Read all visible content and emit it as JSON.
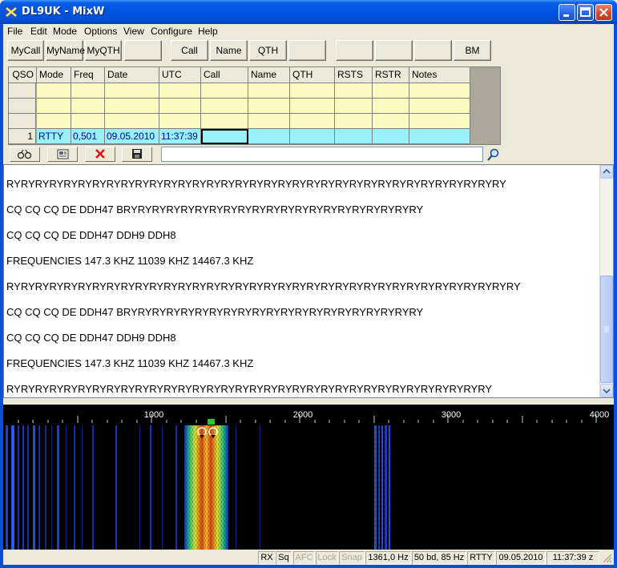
{
  "window": {
    "title": "DL9UK - MixW"
  },
  "menu": [
    "File",
    "Edit",
    "Mode",
    "Options",
    "View",
    "Configure",
    "Help"
  ],
  "buttons": [
    "MyCall",
    "MyName",
    "MyQTH",
    "",
    "Call",
    "Name",
    "QTH",
    "",
    "",
    "",
    "",
    "BM"
  ],
  "grid": {
    "headers": [
      "QSO",
      "Mode",
      "Freq",
      "Date",
      "UTC",
      "Call",
      "Name",
      "QTH",
      "RSTS",
      "RSTR",
      "Notes"
    ],
    "active_row": {
      "qso": "1",
      "mode": "RTTY",
      "freq": "0,501",
      "date": "09.05.2010",
      "utc": "11:37:39",
      "call": "",
      "name": "",
      "qth": "",
      "rsts": "",
      "rstr": "",
      "notes": ""
    }
  },
  "command_input": {
    "value": ""
  },
  "rx_lines": [
    "RYRYRYRYRYRYRYRYRYRYRYRYRYRYRYRYRYRYRYRYRYRYRYRYRYRYRYRYRYRYRYRYRYRYRY",
    "CQ CQ CQ DE DDH47 BRYRYRYRYRYRYRYRYRYRYRYRYRYRYRYRYRYRYRYRYRY",
    "CQ CQ CQ DE DDH47 DDH9 DDH8",
    "FREQUENCIES   147.3 KHZ   11039 KHZ   14467.3 KHZ",
    "RYRYRYRYRYRYRYRYRYRYRYRYRYRYRYRYRYRYRYRYRYRYRYRYRYRYRYRYRYRYRYRYRYRYRYRY",
    "CQ CQ CQ DE DDH47 BRYRYRYRYRYRYRYRYRYRYRYRYRYRYRYRYRYRYRYRYRY",
    "CQ CQ CQ DE DDH47 DDH9 DDH8",
    "FREQUENCIES   147.3 KHZ   11039 KHZ   14467.3 KHZ",
    "RYRYRYRYRYRYRYRYRYRYRYRYRYRYRYRYRYRYRYRYRYRYRYRYRYRYRYRYRYRYRYRYRYRY"
  ],
  "waterfall": {
    "scale_labels": [
      "1000",
      "2000",
      "3000",
      "4000"
    ]
  },
  "status": {
    "rx": "RX",
    "sq": "Sq",
    "afc": "AFC",
    "lock": "Lock",
    "snap": "Snap",
    "freq": "1361,0 Hz",
    "baud": "50 bd, 85 Hz",
    "mode": "RTTY",
    "date": "09.05.2010",
    "time": "11:37:39 z"
  },
  "colors": {
    "title_blue": "#0054e3",
    "grid_yellow": "#fafac0",
    "grid_cyan": "#98f0f8"
  }
}
